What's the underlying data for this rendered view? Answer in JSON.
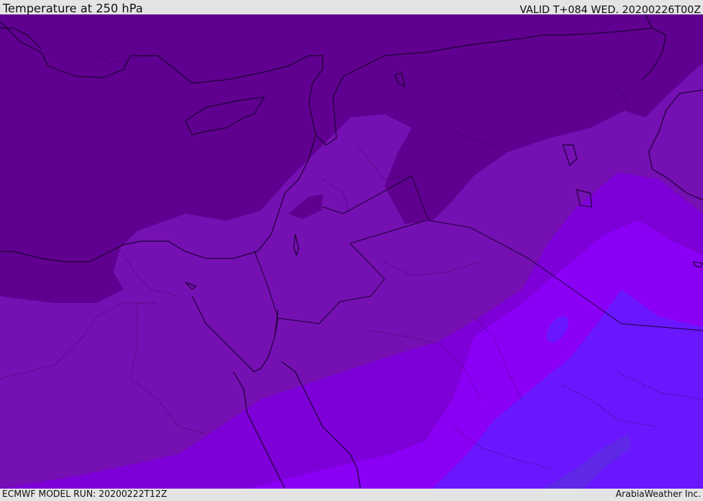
{
  "header": {
    "title": "Temperature at 250 hPa",
    "valid": "VALID T+084 WED. 20200226T00Z"
  },
  "footer": {
    "model_run": "ECMWF MODEL RUN: 20200222T12Z",
    "credit": "ArabiaWeather Inc."
  },
  "map": {
    "field": "temperature-250hpa",
    "fill_colors": [
      "#5f0090",
      "#6b03a3",
      "#7510b2",
      "#7e00d8",
      "#8a00f5",
      "#6a17ff",
      "#5f27e6"
    ],
    "boundary_color": "#1a0030"
  }
}
